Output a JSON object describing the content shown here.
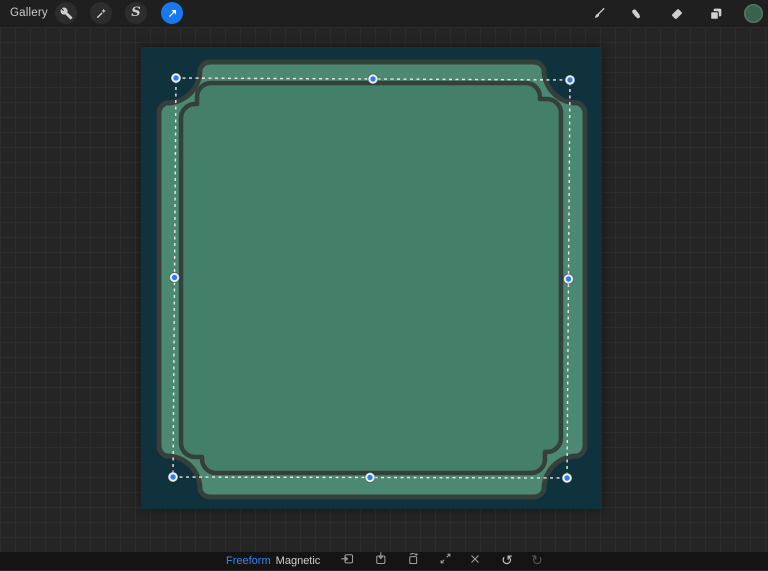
{
  "app": {
    "title": "Procreate transform view"
  },
  "colors": {
    "accent_blue": "#1878f0",
    "toolbar_bg": "#1f1f1f",
    "workspace_bg": "#252525",
    "grid_line": "#2d2d2d",
    "bottombar_bg": "#141414",
    "canvas_bg": "#10323d",
    "frame_outer_fill": "#4d8972",
    "frame_inner_fill": "#447f6a",
    "frame_outline": "#353f3b",
    "selection_dash": "#e8e8e8",
    "handle_blue": "#2b7df7",
    "color_swatch_green": "#3a604f"
  },
  "topbar": {
    "gallery_label": "Gallery",
    "selection_glyph": "S",
    "left_tools": [
      {
        "label": "actions",
        "icon": "wrench-icon"
      },
      {
        "label": "adjustments",
        "icon": "magic-wand-icon"
      },
      {
        "label": "selection",
        "icon": "selection-s-icon"
      },
      {
        "label": "transform",
        "icon": "move-arrow-icon",
        "active": true
      }
    ],
    "right_tools": [
      {
        "label": "paint",
        "icon": "brush-icon"
      },
      {
        "label": "smudge",
        "icon": "finger-icon"
      },
      {
        "label": "erase",
        "icon": "eraser-icon"
      },
      {
        "label": "layers",
        "icon": "layers-icon"
      },
      {
        "label": "color",
        "icon": "color-circle-icon"
      }
    ]
  },
  "bottombar": {
    "modes": [
      {
        "label": "Freeform",
        "active": true
      },
      {
        "label": "Magnetic",
        "active": false
      }
    ],
    "actions": [
      {
        "label": "flip-horizontal",
        "icon": "flip-horizontal-icon"
      },
      {
        "label": "flip-vertical",
        "icon": "flip-vertical-icon"
      },
      {
        "label": "rotate-45",
        "icon": "rotate-45-icon"
      },
      {
        "label": "fit-canvas",
        "icon": "fit-canvas-icon"
      },
      {
        "label": "reset",
        "icon": "x-icon"
      },
      {
        "label": "undo",
        "icon": "undo-icon",
        "glyph": "↺"
      },
      {
        "label": "redo",
        "icon": "redo-icon",
        "glyph": "↻",
        "disabled": true
      }
    ]
  },
  "canvas": {
    "selection": {
      "mode": "Freeform",
      "handle_count": 8
    },
    "artwork": "decorative green frame plaque on dark teal background"
  }
}
